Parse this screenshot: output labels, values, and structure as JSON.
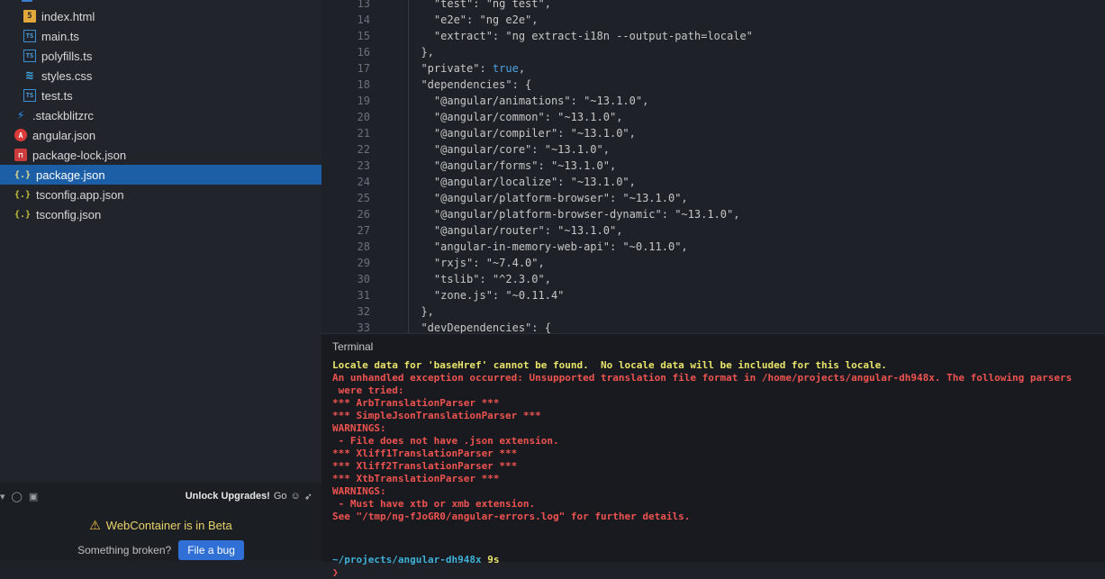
{
  "sidebar": {
    "files": [
      {
        "name": "index.html",
        "icon": "html-file-icon",
        "selected": false
      },
      {
        "name": "main.ts",
        "icon": "ts-file-icon",
        "selected": false
      },
      {
        "name": "polyfills.ts",
        "icon": "ts-file-icon",
        "selected": false
      },
      {
        "name": "styles.css",
        "icon": "css-file-icon",
        "selected": false
      },
      {
        "name": "test.ts",
        "icon": "ts-file-icon",
        "selected": false
      },
      {
        "name": ".stackblitzrc",
        "icon": "stackblitz-bolt-icon",
        "selected": false
      },
      {
        "name": "angular.json",
        "icon": "angular-icon",
        "selected": false
      },
      {
        "name": "package-lock.json",
        "icon": "npm-lock-icon",
        "selected": false
      },
      {
        "name": "package.json",
        "icon": "json-file-icon",
        "selected": true
      },
      {
        "name": "tsconfig.app.json",
        "icon": "json-file-icon",
        "selected": false
      },
      {
        "name": "tsconfig.json",
        "icon": "json-file-icon",
        "selected": false
      }
    ],
    "bottom": {
      "unlock_label": "Unlock Upgrades!",
      "go_label": "Go",
      "beta_text": "WebContainer is in Beta",
      "broken_text": "Something broken?",
      "file_bug_label": "File a bug"
    }
  },
  "editor": {
    "lines": [
      {
        "n": "13",
        "text": "    \"test\": \"ng test\","
      },
      {
        "n": "14",
        "text": "    \"e2e\": \"ng e2e\","
      },
      {
        "n": "15",
        "text": "    \"extract\": \"ng extract-i18n --output-path=locale\""
      },
      {
        "n": "16",
        "text": "  },"
      },
      {
        "n": "17",
        "text": "  \"private\": true,"
      },
      {
        "n": "18",
        "text": "  \"dependencies\": {"
      },
      {
        "n": "19",
        "text": "    \"@angular/animations\": \"~13.1.0\","
      },
      {
        "n": "20",
        "text": "    \"@angular/common\": \"~13.1.0\","
      },
      {
        "n": "21",
        "text": "    \"@angular/compiler\": \"~13.1.0\","
      },
      {
        "n": "22",
        "text": "    \"@angular/core\": \"~13.1.0\","
      },
      {
        "n": "23",
        "text": "    \"@angular/forms\": \"~13.1.0\","
      },
      {
        "n": "24",
        "text": "    \"@angular/localize\": \"~13.1.0\","
      },
      {
        "n": "25",
        "text": "    \"@angular/platform-browser\": \"~13.1.0\","
      },
      {
        "n": "26",
        "text": "    \"@angular/platform-browser-dynamic\": \"~13.1.0\","
      },
      {
        "n": "27",
        "text": "    \"@angular/router\": \"~13.1.0\","
      },
      {
        "n": "28",
        "text": "    \"angular-in-memory-web-api\": \"~0.11.0\","
      },
      {
        "n": "29",
        "text": "    \"rxjs\": \"~7.4.0\","
      },
      {
        "n": "30",
        "text": "    \"tslib\": \"^2.3.0\","
      },
      {
        "n": "31",
        "text": "    \"zone.js\": \"~0.11.4\""
      },
      {
        "n": "32",
        "text": "  },"
      },
      {
        "n": "33",
        "text": "  \"devDependencies\": {"
      }
    ]
  },
  "terminal": {
    "title": "Terminal",
    "lines": [
      {
        "text": "Locale data for 'baseHref' cannot be found.  No locale data will be included for this locale.",
        "color": "yellow"
      },
      {
        "text": "An unhandled exception occurred: Unsupported translation file format in /home/projects/angular-dh948x. The following parsers",
        "color": "red"
      },
      {
        "text": " were tried:",
        "color": "red"
      },
      {
        "text": "*** ArbTranslationParser ***",
        "color": "red"
      },
      {
        "text": "*** SimpleJsonTranslationParser ***",
        "color": "red"
      },
      {
        "text": "WARNINGS:",
        "color": "red"
      },
      {
        "text": " - File does not have .json extension.",
        "color": "red"
      },
      {
        "text": "*** Xliff1TranslationParser ***",
        "color": "red"
      },
      {
        "text": "*** Xliff2TranslationParser ***",
        "color": "red"
      },
      {
        "text": "*** XtbTranslationParser ***",
        "color": "red"
      },
      {
        "text": "WARNINGS:",
        "color": "red"
      },
      {
        "text": " - Must have xtb or xmb extension.",
        "color": "red"
      },
      {
        "text": "See \"/tmp/ng-fJoGR0/angular-errors.log\" for further details.",
        "color": "red"
      }
    ],
    "prompt_path": "~/projects/angular-dh948x",
    "prompt_time": "9s",
    "prompt_symbol": "❯"
  }
}
